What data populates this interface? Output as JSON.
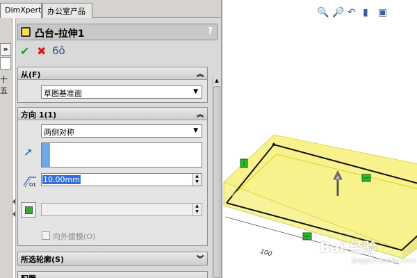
{
  "tabs": [
    "DimXpert",
    "办公室产品"
  ],
  "left_strip": {
    "chevron": "»",
    "char": "十五"
  },
  "panel": {
    "title": "凸台-拉伸1",
    "help": "?",
    "actions": {
      "ok": "✔",
      "cancel": "✖",
      "preview": "6ô"
    }
  },
  "from_group": {
    "title": "从(F)",
    "combo_value": "草图基准面"
  },
  "direction_group": {
    "title": "方向 1(1)",
    "end_condition": "两侧对称",
    "depth_value": "10.00mm",
    "depth_icon_label": "D1",
    "draft_outward_label": "向外拔模(O)"
  },
  "collapsed_groups": [
    {
      "title": "所选轮廓(S)"
    },
    {
      "title": "配置"
    }
  ],
  "viewport": {
    "toolbar_icons": [
      "zoom-to-fit-icon",
      "zoom-area-icon",
      "previous-view-icon",
      "section-view-icon",
      "view-orientation-icon"
    ],
    "dimension_label": "100",
    "watermark": "Bai 经验",
    "watermark_url": "jingyan.baidu.com"
  },
  "colors": {
    "panel_bg": "#d9d9d9",
    "extrude_preview": "#f5f07a",
    "handle_green": "#2bbb2b",
    "selection_blue": "#6fa8e8"
  }
}
